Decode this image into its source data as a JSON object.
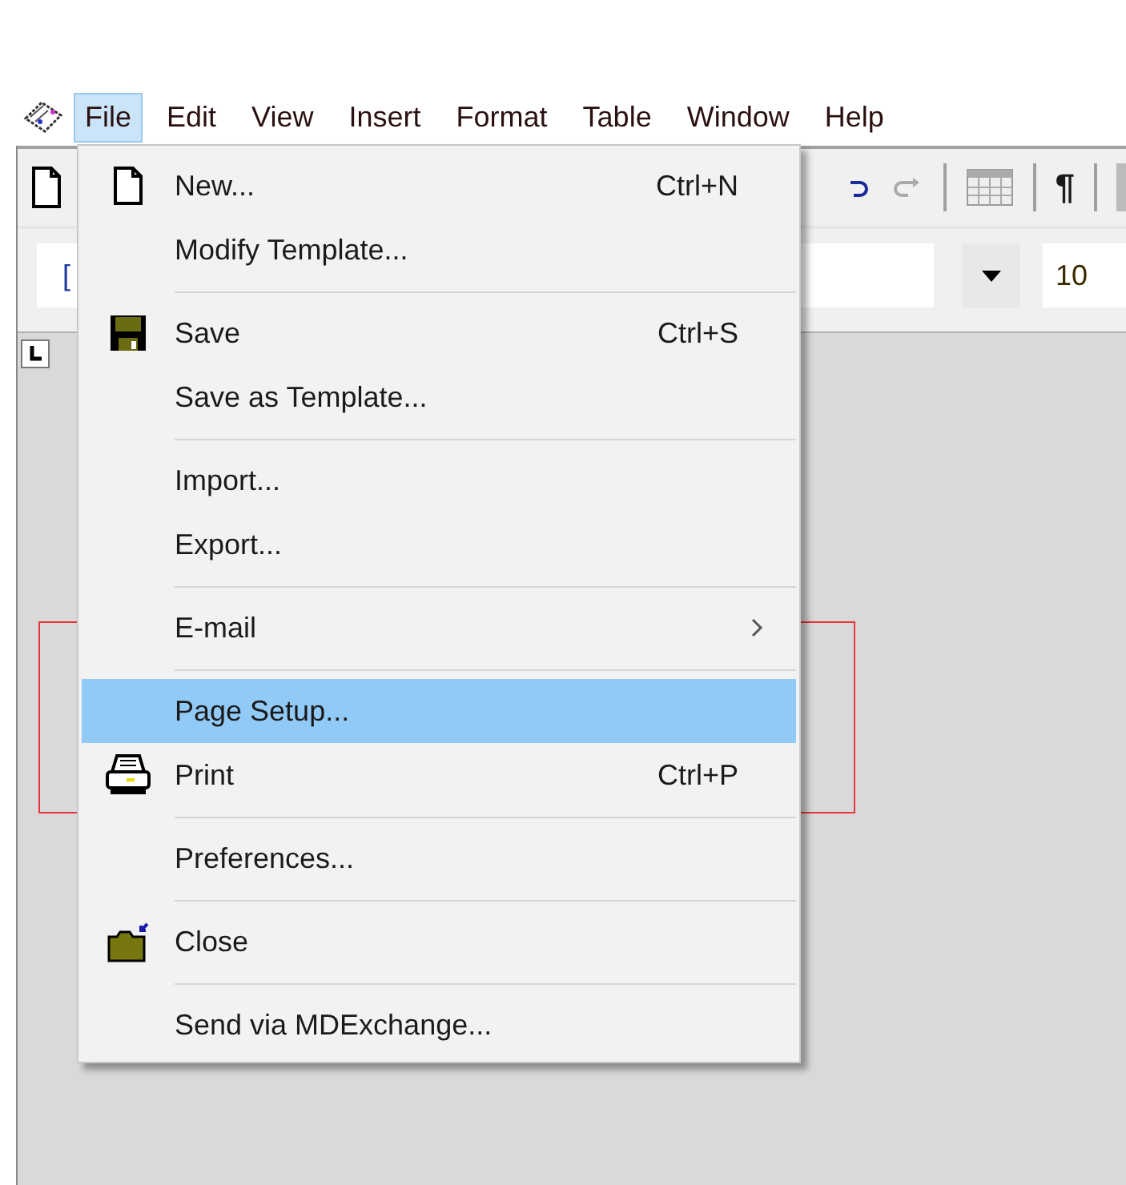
{
  "menubar": [
    {
      "label": "File",
      "selected": true
    },
    {
      "label": "Edit",
      "selected": false
    },
    {
      "label": "View",
      "selected": false
    },
    {
      "label": "Insert",
      "selected": false
    },
    {
      "label": "Format",
      "selected": false
    },
    {
      "label": "Table",
      "selected": false
    },
    {
      "label": "Window",
      "selected": false
    },
    {
      "label": "Help",
      "selected": false
    }
  ],
  "toolbar": {
    "pilcrow": "¶"
  },
  "format_bar": {
    "style_value": "[",
    "font_size": "10"
  },
  "file_menu": [
    {
      "kind": "item",
      "label": "New...",
      "shortcut": "Ctrl+N",
      "selected": false
    },
    {
      "kind": "item",
      "label": "Modify Template...",
      "selected": false
    },
    {
      "kind": "separator"
    },
    {
      "kind": "item",
      "label": "Save",
      "shortcut": "Ctrl+S",
      "selected": false
    },
    {
      "kind": "item",
      "label": "Save as Template...",
      "selected": false
    },
    {
      "kind": "separator"
    },
    {
      "kind": "item",
      "label": "Import...",
      "selected": false
    },
    {
      "kind": "item",
      "label": "Export...",
      "selected": false
    },
    {
      "kind": "separator"
    },
    {
      "kind": "item",
      "label": "E-mail",
      "submenu": true,
      "selected": false
    },
    {
      "kind": "separator"
    },
    {
      "kind": "item",
      "label": "Page Setup...",
      "selected": true
    },
    {
      "kind": "item",
      "label": "Print",
      "shortcut": "Ctrl+P",
      "selected": false
    },
    {
      "kind": "separator"
    },
    {
      "kind": "item",
      "label": "Preferences...",
      "selected": false
    },
    {
      "kind": "separator"
    },
    {
      "kind": "item",
      "label": "Close",
      "selected": false
    },
    {
      "kind": "separator"
    },
    {
      "kind": "item",
      "label": "Send via MDExchange...",
      "selected": false
    }
  ]
}
